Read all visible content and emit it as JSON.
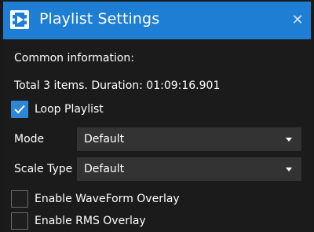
{
  "window": {
    "title": "Playlist Settings",
    "close_glyph": "✕",
    "title_bar_color": "#1e7ed3",
    "background_color": "#1b1b1b"
  },
  "info": {
    "heading": "Common information:",
    "summary": "Total 3 items. Duration: 01:09:16.901"
  },
  "loop_playlist": {
    "label": "Loop Playlist",
    "checked": true
  },
  "mode": {
    "label": "Mode",
    "selected": "Default"
  },
  "scale_type": {
    "label": "Scale Type",
    "selected": "Default"
  },
  "waveform_overlay": {
    "label": "Enable WaveForm Overlay",
    "checked": false
  },
  "rms_overlay": {
    "label": "Enable RMS Overlay",
    "checked": false
  },
  "icons": {
    "app": "film-play-icon",
    "close": "close-icon",
    "dropdown": "chevron-down-icon",
    "check": "checkmark-icon"
  },
  "colors": {
    "accent": "#2f86d7",
    "combo_bg": "#333333"
  }
}
